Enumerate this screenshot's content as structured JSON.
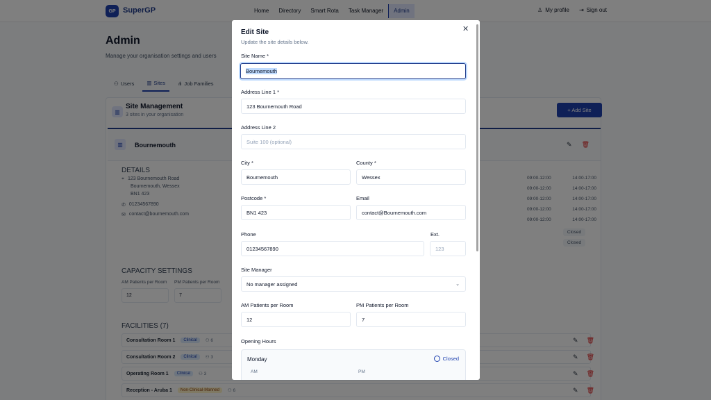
{
  "app": {
    "logo_mark": "GP",
    "name": "SuperGP",
    "nav": [
      "Home",
      "Directory",
      "Smart Rota",
      "Task Manager",
      "Admin"
    ],
    "active_nav": "Admin",
    "my_profile": "My profile",
    "sign_out": "Sign out"
  },
  "page": {
    "title": "Admin",
    "subtitle": "Manage your organisation settings and users",
    "tabs": [
      {
        "label": "Users",
        "icon": "users-icon"
      },
      {
        "label": "Sites",
        "icon": "building-icon"
      },
      {
        "label": "Job Families",
        "icon": "hierarchy-icon"
      }
    ],
    "active_tab": "Sites"
  },
  "site_management": {
    "title": "Site Management",
    "subtitle": "3 sites in your organisation",
    "add_button": "+ Add Site",
    "site": {
      "name": "Bournemouth",
      "details_heading": "DETAILS",
      "address": [
        "123 Bournemouth Road",
        "Bournemouth, Wessex",
        "BN1 423"
      ],
      "phone": "01234567890",
      "email": "contact@bournemouth.com",
      "hours": [
        [
          "09:00-12:00",
          "14:00-17:00"
        ],
        [
          "09:00-12:00",
          "14:00-17:00"
        ],
        [
          "09:00-12:00",
          "14:00-17:00"
        ],
        [
          "09:00-12:00",
          "14:00-17:00"
        ],
        [
          "09:00-12:00",
          "14:00-17:00"
        ]
      ],
      "closed_labels": [
        "Closed",
        "Closed"
      ],
      "capacity_heading": "CAPACITY SETTINGS",
      "am_label": "AM Patients per Room",
      "pm_label": "PM Patients per Room",
      "am_value": "12",
      "pm_value": "7",
      "facilities_heading": "FACILITIES (7)",
      "facilities": [
        {
          "name": "Consultation Room 1",
          "type": "Clinical",
          "count": "6"
        },
        {
          "name": "Consultation Room 2",
          "type": "Clinical",
          "count": "3"
        },
        {
          "name": "Operating Room 1",
          "type": "Clinical",
          "count": "3"
        },
        {
          "name": "Reception - Aruba 1",
          "type": "Non-Clinical-Manned",
          "count": "6"
        }
      ]
    }
  },
  "modal": {
    "title": "Edit Site",
    "subtitle": "Update the site details below.",
    "fields": {
      "site_name": {
        "label": "Site Name *",
        "value": "Bournemouth"
      },
      "address1": {
        "label": "Address Line 1 *",
        "value": "123 Bournemouth Road"
      },
      "address2": {
        "label": "Address Line 2",
        "placeholder": "Suite 100 (optional)"
      },
      "city": {
        "label": "City *",
        "value": "Bournemouth"
      },
      "county": {
        "label": "County *",
        "value": "Wessex"
      },
      "postcode": {
        "label": "Postcode *",
        "value": "BN1 423"
      },
      "email": {
        "label": "Email",
        "value": "contact@Bournemouth.com"
      },
      "phone": {
        "label": "Phone",
        "value": "01234567890"
      },
      "ext": {
        "label": "Ext.",
        "placeholder": "123"
      },
      "site_manager": {
        "label": "Site Manager",
        "value": "No manager assigned"
      },
      "am_patients": {
        "label": "AM Patients per Room",
        "value": "12"
      },
      "pm_patients": {
        "label": "PM Patients per Room",
        "value": "7"
      }
    },
    "opening_hours": {
      "label": "Opening Hours",
      "day": "Monday",
      "closed_label": "Closed",
      "am": "AM",
      "pm": "PM"
    }
  }
}
